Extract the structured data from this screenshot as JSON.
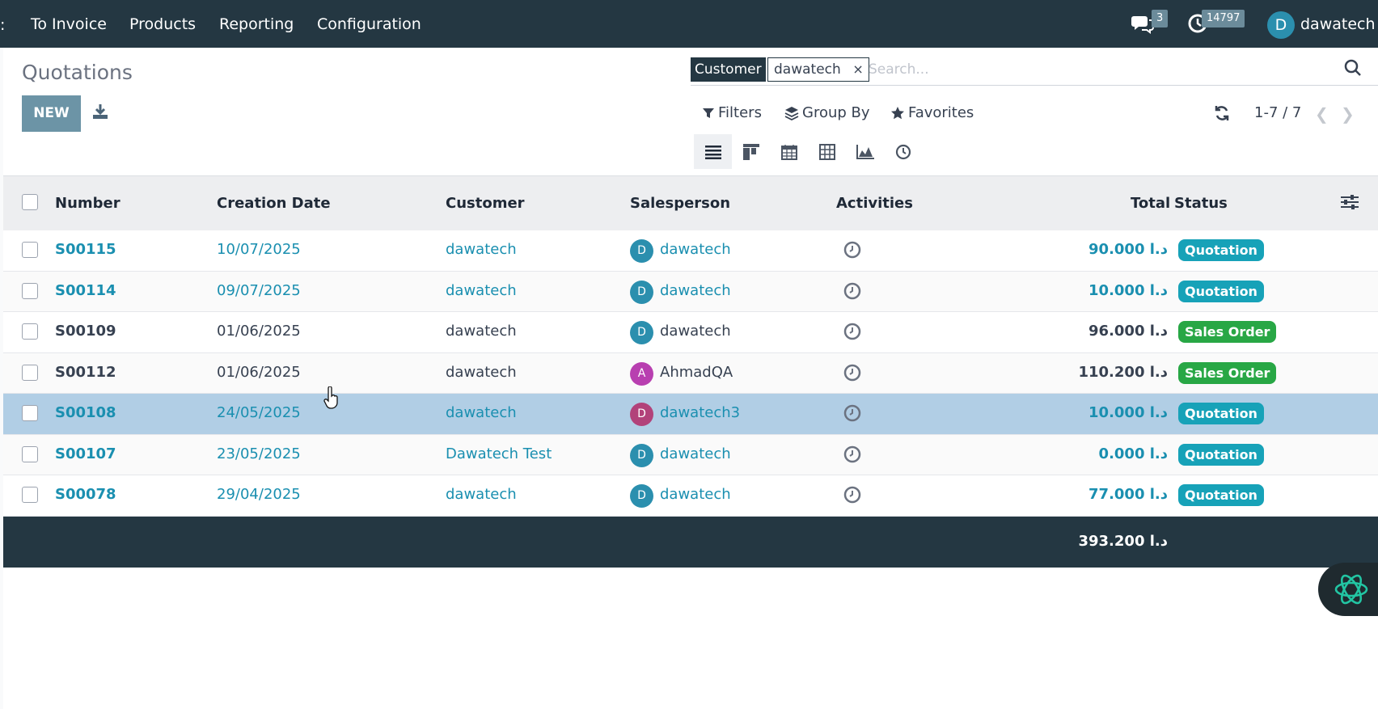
{
  "navbar": {
    "edge_glyph": ":",
    "menu": [
      "To Invoice",
      "Products",
      "Reporting",
      "Configuration"
    ],
    "messages_count": "3",
    "activities_count": "14797",
    "user_initial": "D",
    "user_name": "dawatech",
    "icons": {
      "messages": "chat-bubbles-icon",
      "activities": "clock-icon"
    }
  },
  "page": {
    "title": "Quotations",
    "new_button": "NEW",
    "download_icon": "download-icon"
  },
  "search": {
    "facet_label": "Customer",
    "facet_value": "dawatech",
    "facet_remove": "×",
    "placeholder": "Search..."
  },
  "toolbar": {
    "filters": "Filters",
    "group_by": "Group By",
    "favorites": "Favorites",
    "pager": "1-7 / 7",
    "views": [
      "list-view-icon",
      "kanban-view-icon",
      "calendar-view-icon",
      "pivot-view-icon",
      "graph-view-icon",
      "activity-view-icon"
    ],
    "active_view": "list"
  },
  "table": {
    "columns": {
      "number": "Number",
      "creation_date": "Creation Date",
      "customer": "Customer",
      "salesperson": "Salesperson",
      "activities": "Activities",
      "total": "Total",
      "status": "Status"
    },
    "rows": [
      {
        "number": "S00115",
        "date": "10/07/2025",
        "customer": "dawatech",
        "sp_initial": "D",
        "sp_name": "dawatech",
        "sp_color": "#2b8fae",
        "total": "90.000 د.ا",
        "status": "Quotation",
        "status_color": "#17a2b8",
        "style": "link"
      },
      {
        "number": "S00114",
        "date": "09/07/2025",
        "customer": "dawatech",
        "sp_initial": "D",
        "sp_name": "dawatech",
        "sp_color": "#2b8fae",
        "total": "10.000 د.ا",
        "status": "Quotation",
        "status_color": "#17a2b8",
        "style": "link"
      },
      {
        "number": "S00109",
        "date": "01/06/2025",
        "customer": "dawatech",
        "sp_initial": "D",
        "sp_name": "dawatech",
        "sp_color": "#2b8fae",
        "total": "96.000 د.ا",
        "status": "Sales Order",
        "status_color": "#28a745",
        "style": "plain"
      },
      {
        "number": "S00112",
        "date": "01/06/2025",
        "customer": "dawatech",
        "sp_initial": "A",
        "sp_name": "AhmadQA",
        "sp_color": "#b83fb0",
        "total": "110.200 د.ا",
        "status": "Sales Order",
        "status_color": "#28a745",
        "style": "plain"
      },
      {
        "number": "S00108",
        "date": "24/05/2025",
        "customer": "dawatech",
        "sp_initial": "D",
        "sp_name": "dawatech3",
        "sp_color": "#b2427a",
        "total": "10.000 د.ا",
        "status": "Quotation",
        "status_color": "#17a2b8",
        "style": "link"
      },
      {
        "number": "S00107",
        "date": "23/05/2025",
        "customer": "Dawatech Test",
        "sp_initial": "D",
        "sp_name": "dawatech",
        "sp_color": "#2b8fae",
        "total": "0.000 د.ا",
        "status": "Quotation",
        "status_color": "#17a2b8",
        "style": "link"
      },
      {
        "number": "S00078",
        "date": "29/04/2025",
        "customer": "dawatech",
        "sp_initial": "D",
        "sp_name": "dawatech",
        "sp_color": "#2b8fae",
        "total": "77.000 د.ا",
        "status": "Quotation",
        "status_color": "#17a2b8",
        "style": "link"
      }
    ],
    "selected_row": 4,
    "grand_total": "393.200 د.ا"
  },
  "colors": {
    "navbar": "#243742",
    "link": "#1a8fb0",
    "primary_button": "#6c94a6",
    "quotation_badge": "#17a2b8",
    "sales_order_badge": "#28a745",
    "selected_row": "#b1cee5"
  },
  "assistant_icon": "ai-assistant-icon"
}
